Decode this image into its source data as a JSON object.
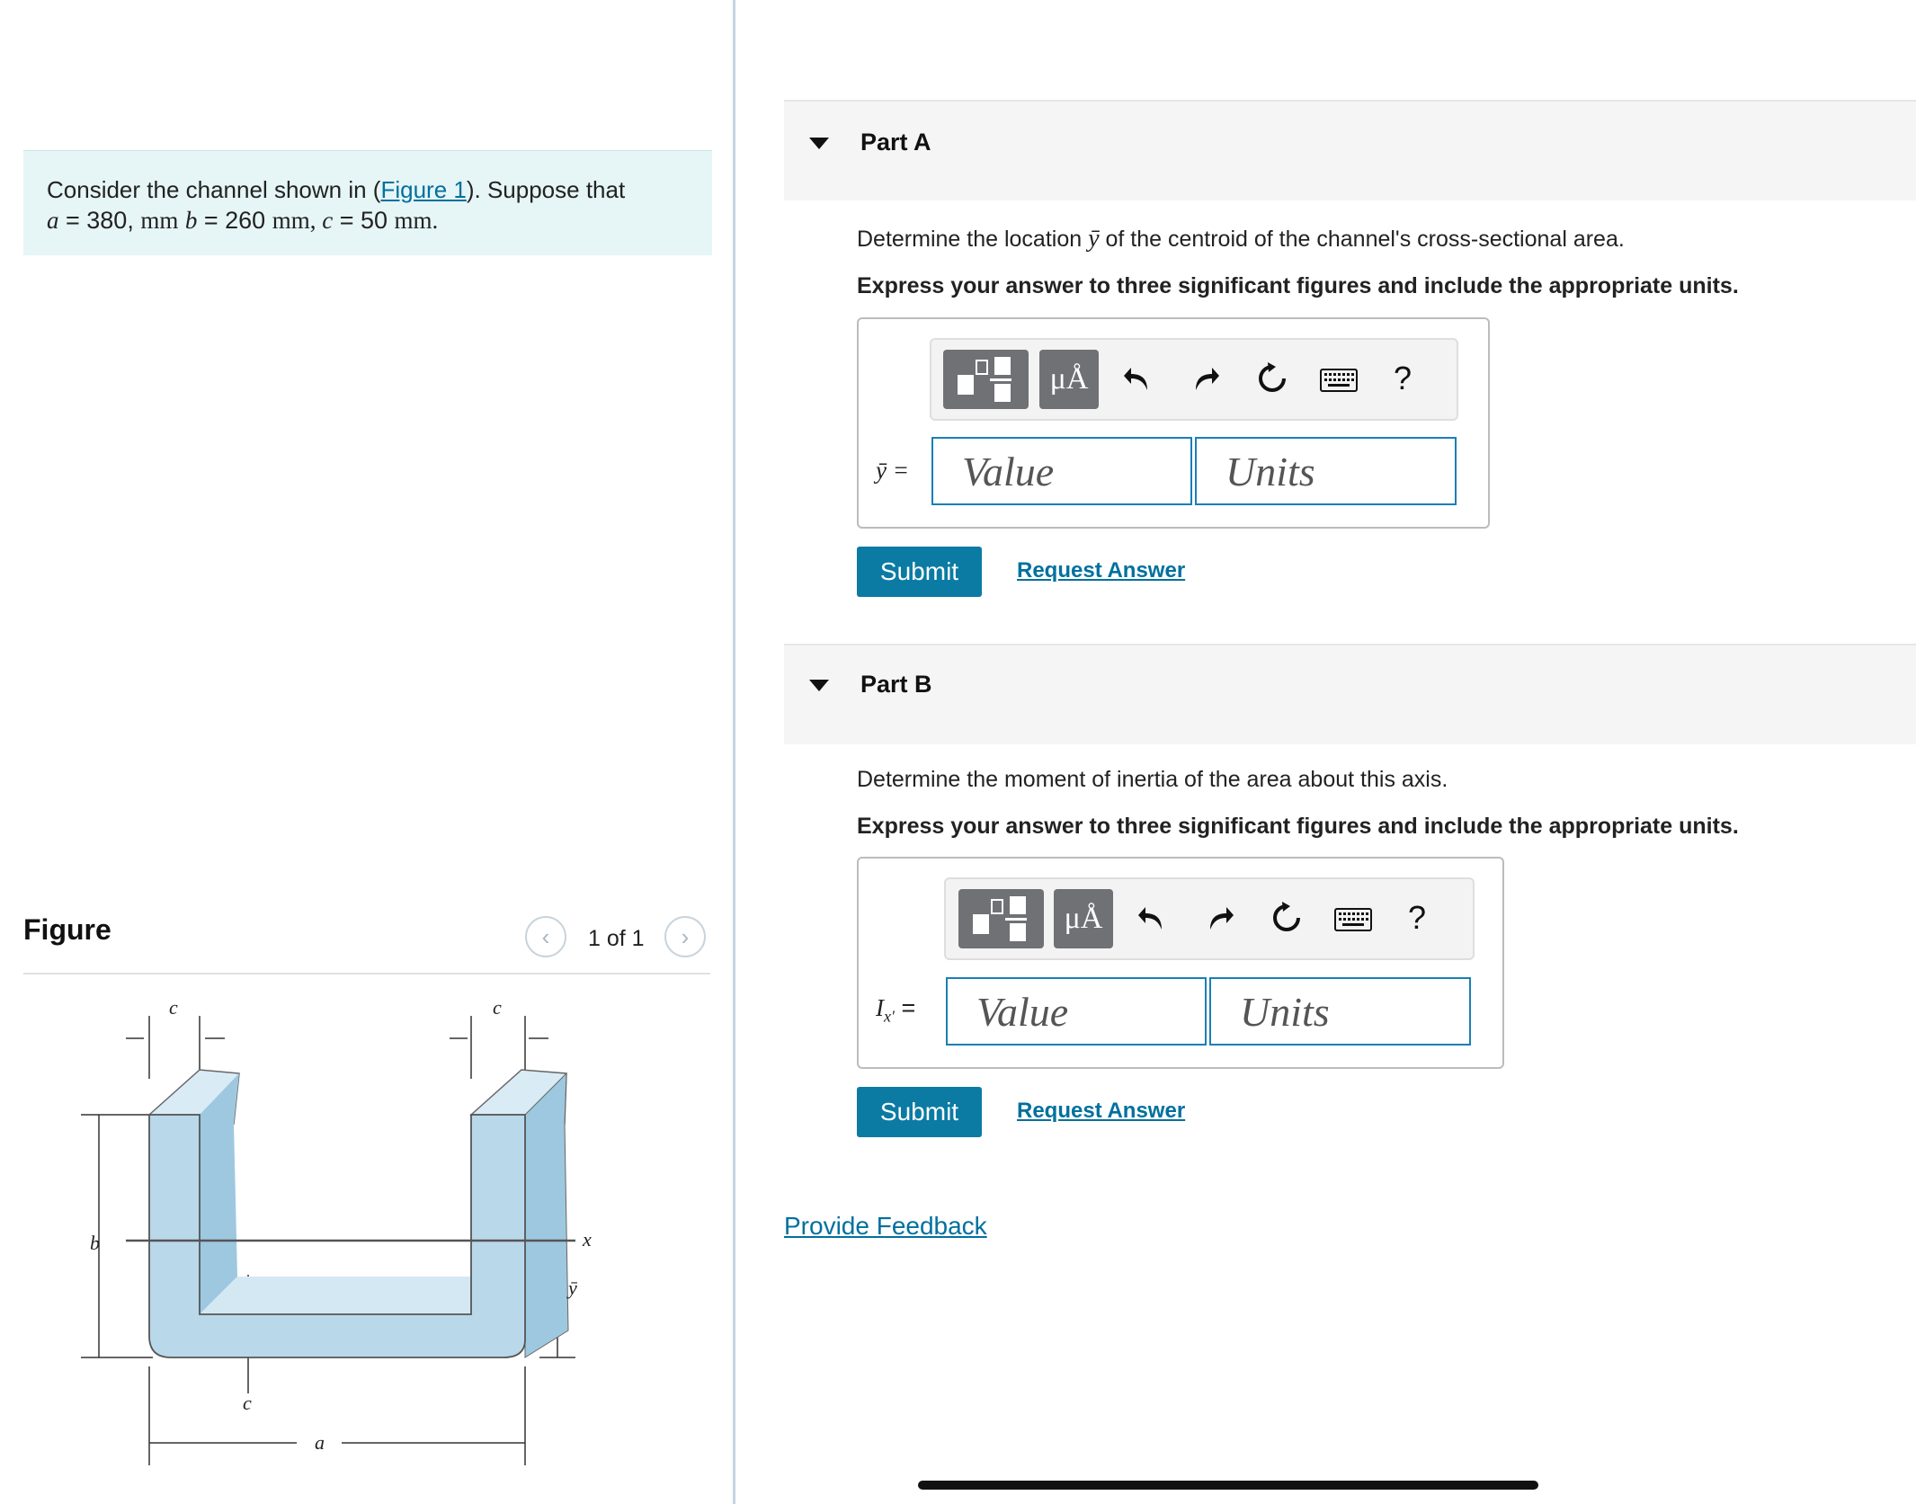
{
  "problem": {
    "line1_prefix": "Consider the channel shown in (",
    "figure_link": "Figure 1",
    "line1_suffix": "). Suppose that",
    "a_var": "a",
    "a_eq": " = 380, ",
    "a_unit": "mm",
    "b_var": "b",
    "b_eq": " = 260 ",
    "b_unit": "mm",
    "c_var": "c",
    "c_eq": " = 50 ",
    "c_unit": "mm."
  },
  "figure": {
    "title": "Figure",
    "counter": "1 of 1",
    "prev_glyph": "‹",
    "next_glyph": "›",
    "labels": {
      "c_left": "c",
      "c_right": "c",
      "b": "b",
      "x": "x",
      "ybar": "ȳ",
      "c_bottom": "c",
      "a": "a"
    },
    "fill_color": "#b9d8ea"
  },
  "partA": {
    "title": "Part A",
    "prompt_pre": "Determine the location ",
    "prompt_var": "ȳ",
    "prompt_post": " of the centroid of the channel's cross-sectional area.",
    "instruction": "Express your answer to three significant figures and include the appropriate units.",
    "var_label": "ȳ =",
    "value_placeholder": "Value",
    "units_placeholder": "Units",
    "submit": "Submit",
    "request": "Request Answer"
  },
  "partB": {
    "title": "Part B",
    "prompt": "Determine the moment of inertia of the area about this axis.",
    "instruction": "Express your answer to three significant figures and include the appropriate units.",
    "var_label_main": "I",
    "var_label_sub": "x′",
    "var_label_eq": " =",
    "value_placeholder": "Value",
    "units_placeholder": "Units",
    "submit": "Submit",
    "request": "Request Answer"
  },
  "toolbar": {
    "units_glyph": "μÅ",
    "help_glyph": "?"
  },
  "feedback": "Provide Feedback",
  "colors": {
    "accent": "#0b7ba3",
    "link": "#00709e",
    "problem_bg": "#e6f5f6"
  }
}
